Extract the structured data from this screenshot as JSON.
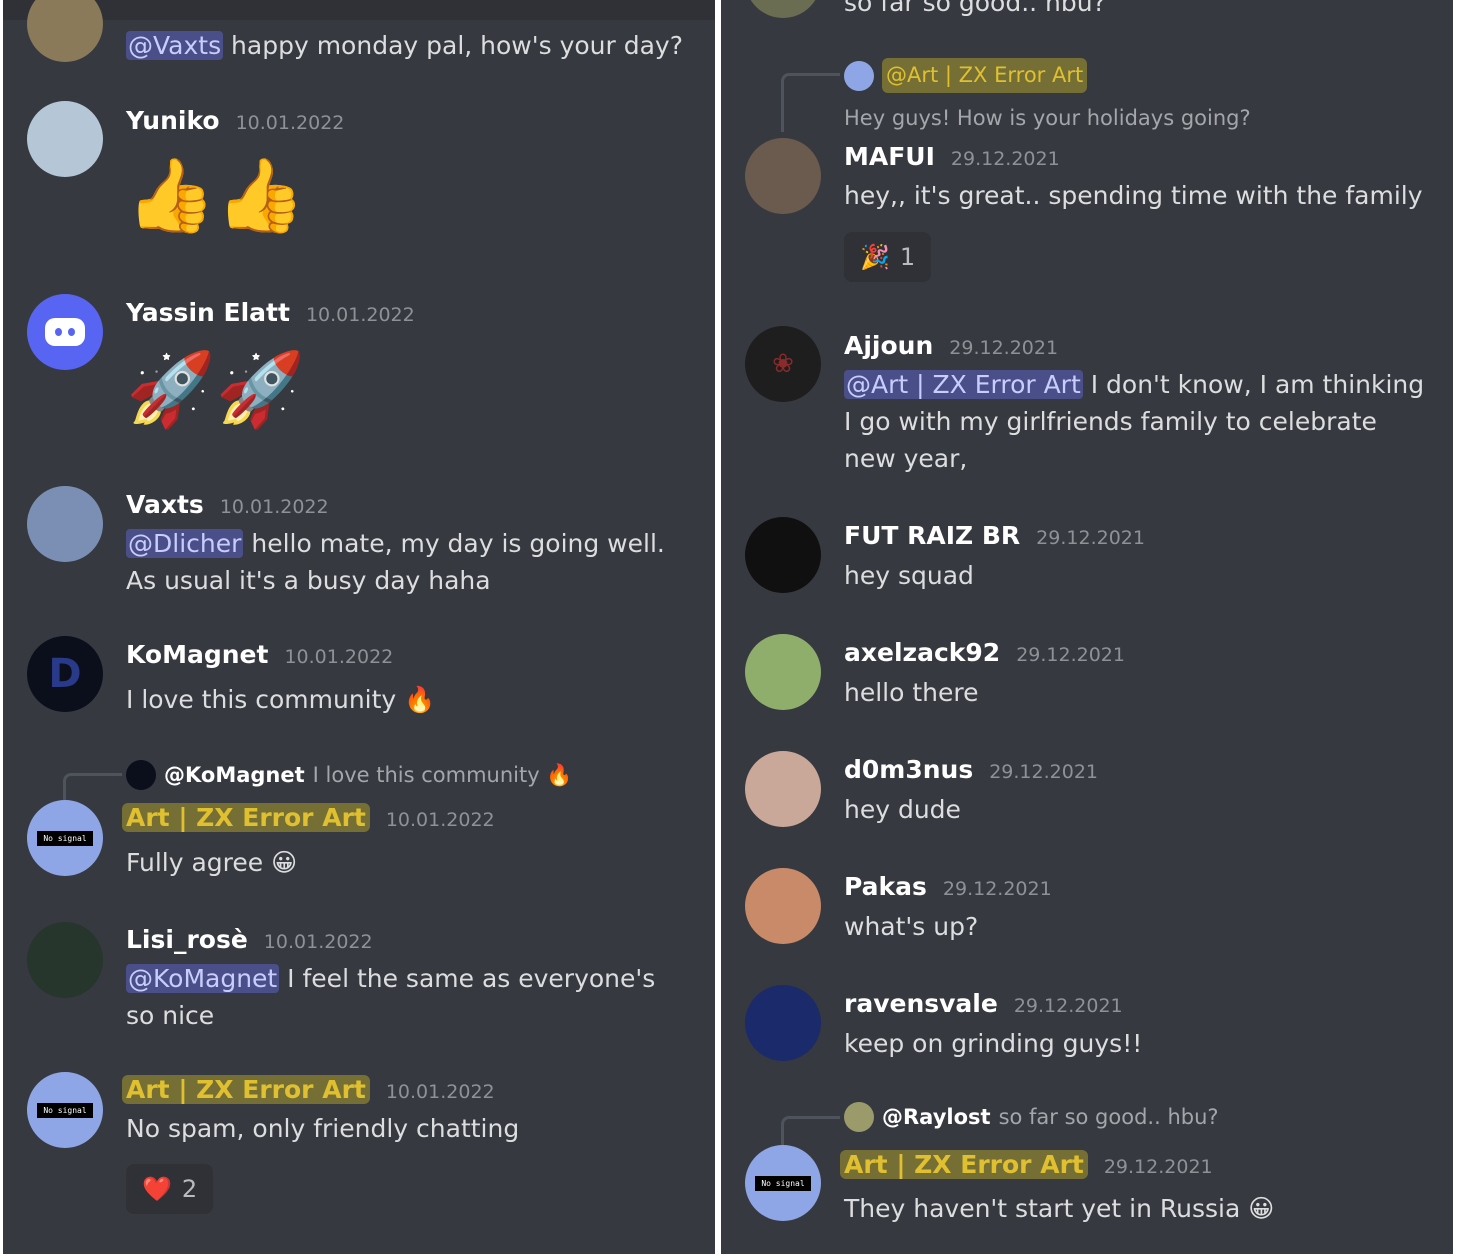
{
  "left": {
    "messages": [
      {
        "author": "",
        "time": "",
        "mention": "@Vaxts",
        "text": " happy monday pal, how's your day?"
      },
      {
        "author": "Yuniko",
        "time": "10.01.2022",
        "emoji": "👍👍"
      },
      {
        "author": "Yassin Elatt",
        "time": "10.01.2022",
        "emoji": "🚀🚀"
      },
      {
        "author": "Vaxts",
        "time": "10.01.2022",
        "mention": "@Dlicher",
        "text": " hello mate, my day is going well. As usual it's a busy day haha"
      },
      {
        "author": "KoMagnet",
        "time": "10.01.2022",
        "text": "I love this community 🔥"
      },
      {
        "reply_author": "@KoMagnet",
        "reply_text": "I love this community 🔥",
        "author": "Art | ZX Error Art",
        "time": "10.01.2022",
        "text": "Fully agree 😀"
      },
      {
        "author": "Lisi_rosè",
        "time": "10.01.2022",
        "mention": "@KoMagnet",
        "text": " I feel the same as everyone's so nice"
      },
      {
        "author": "Art | ZX Error Art",
        "time": "10.01.2022",
        "text": "No spam, only friendly chatting",
        "reaction_emoji": "❤️",
        "reaction_count": "2"
      }
    ],
    "avatar_label": "No signal"
  },
  "right": {
    "top_cut_text": "so far so good.. hbu?",
    "messages": [
      {
        "reply_author": "@Art | ZX Error Art",
        "reply_text": "Hey guys! How is your holidays going?",
        "author": "MAFUI",
        "time": "29.12.2021",
        "text": "hey,, it's great.. spending time with the family",
        "reaction_emoji": "🎉",
        "reaction_count": "1"
      },
      {
        "author": "Ajjoun",
        "time": "29.12.2021",
        "mention": "@Art | ZX Error Art",
        "text": " I don't know, I am thinking I go with my girlfriends family to celebrate new year,"
      },
      {
        "author": "FUT RAIZ BR",
        "time": "29.12.2021",
        "text": "hey squad"
      },
      {
        "author": "axelzack92",
        "time": "29.12.2021",
        "text": "hello there"
      },
      {
        "author": "d0m3nus",
        "time": "29.12.2021",
        "text": "hey dude"
      },
      {
        "author": "Pakas",
        "time": "29.12.2021",
        "text": "what's up?"
      },
      {
        "author": "ravensvale",
        "time": "29.12.2021",
        "text": "keep on grinding guys!!"
      },
      {
        "reply_author": "@Raylost",
        "reply_text": "so far so good.. hbu?",
        "author": "Art | ZX Error Art",
        "time": "29.12.2021",
        "text": "They haven't start yet in Russia 😀"
      }
    ]
  },
  "colors": {
    "background": "#36393f",
    "username": "#ffffff",
    "highlight_name": "#e0c030",
    "mention_bg": "#4a4f8a",
    "timestamp": "#8e9297",
    "discord_blurple": "#5865f2"
  },
  "icons": [
    "thumbs-up",
    "rocket",
    "fire",
    "grinning-face",
    "red-heart",
    "party-popper",
    "discord-logo"
  ]
}
